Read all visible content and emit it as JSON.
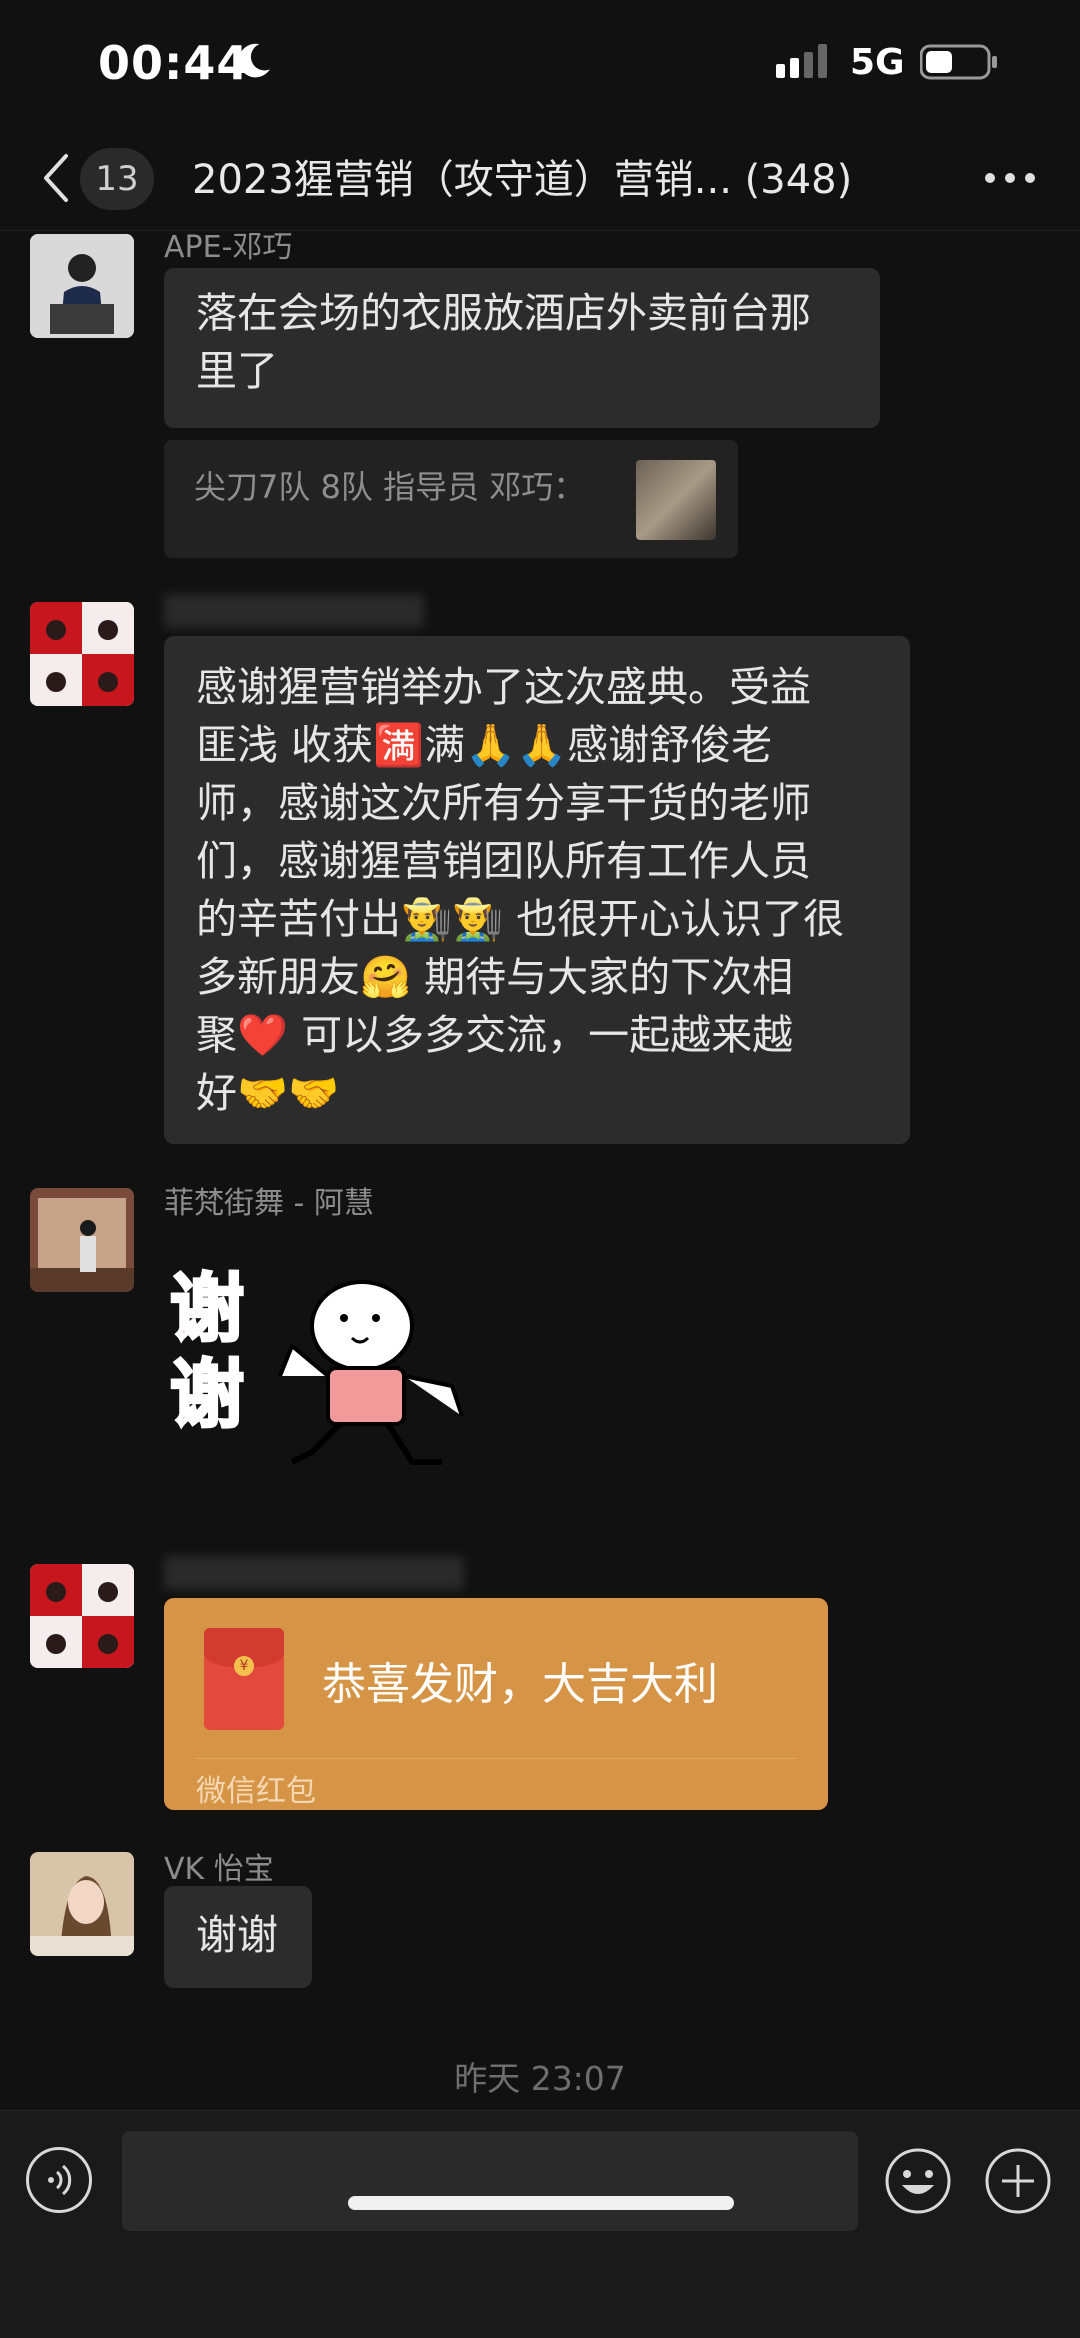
{
  "status_bar": {
    "time": "00:44",
    "network": "5G"
  },
  "nav": {
    "unread_count": "13",
    "title": "2023猩营销（攻守道）营销... (348)"
  },
  "messages": [
    {
      "sender": "APE-邓巧",
      "text": "落在会场的衣服放酒店外卖前台那里了",
      "quote": "尖刀7队 8队 指导员 邓巧："
    },
    {
      "sender": "",
      "text_lines": [
        "感谢猩营销举办了这次盛典。受益",
        "匪浅 收获🈵满🙏🙏感谢舒俊老",
        "师，感谢这次所有分享干货的老师",
        "们，感谢猩营销团队所有工作人员",
        "的辛苦付出👨‍🌾👨‍🌾 也很开心认识了很",
        "多新朋友🤗 期待与大家的下次相",
        "聚❤️  可以多多交流，一起越来越",
        "好🤝🤝"
      ]
    },
    {
      "sender": "菲梵街舞 - 阿慧",
      "sticker_text": "谢谢"
    },
    {
      "sender": "",
      "red_packet": {
        "text": "恭喜发财，大吉大利",
        "label": "微信红包"
      }
    },
    {
      "sender": "VK 怡宝",
      "text": "谢谢"
    }
  ],
  "timestamp": "昨天 23:07",
  "colors": {
    "background": "#111111",
    "bubble": "#2c2c2c",
    "red_packet": "#d69447"
  }
}
